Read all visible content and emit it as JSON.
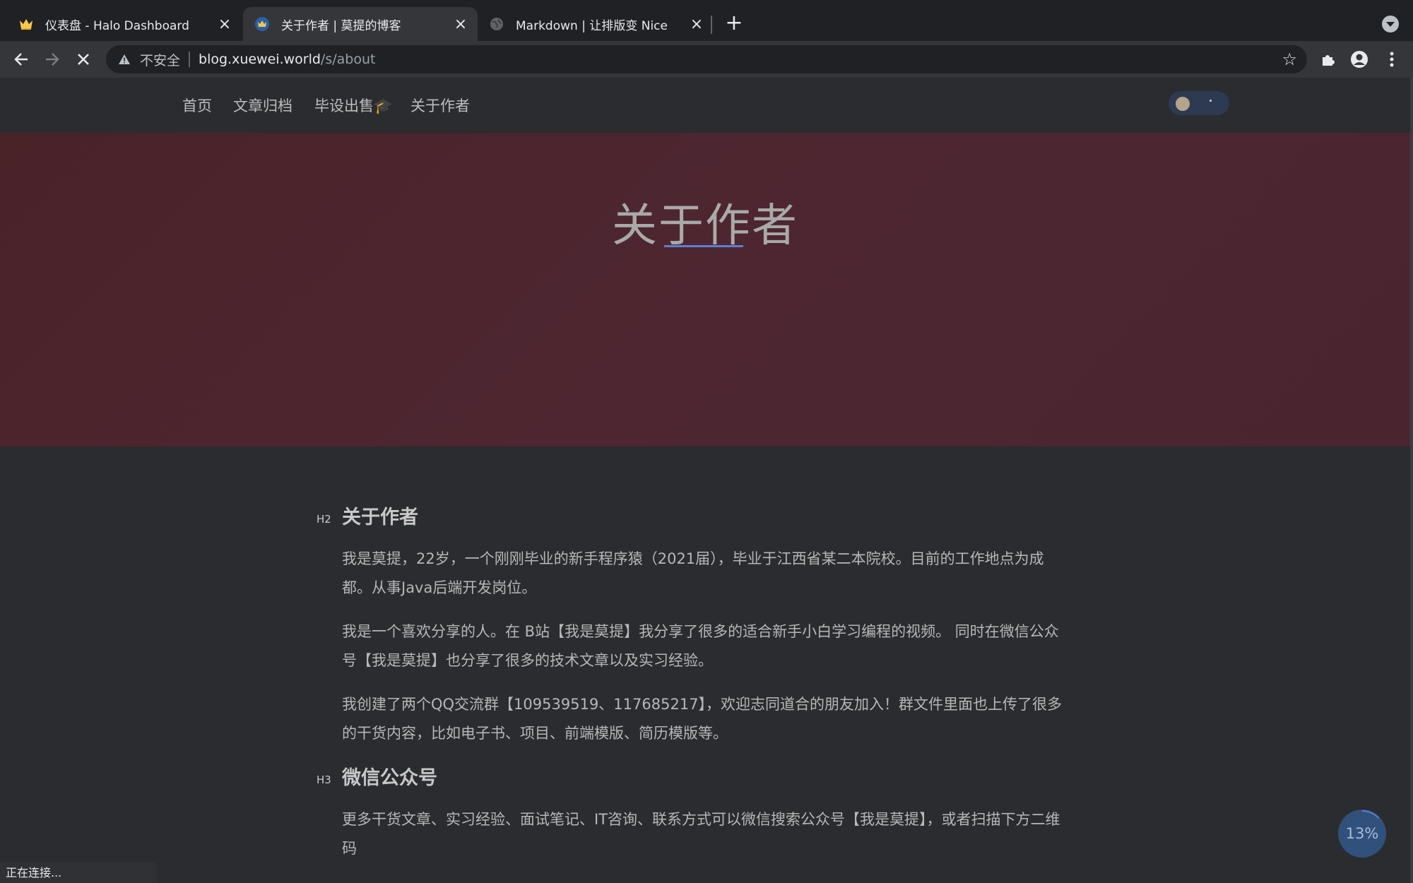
{
  "browser": {
    "tabs": [
      {
        "title": "仪表盘 - Halo Dashboard",
        "icon": "crown-icon",
        "active": false
      },
      {
        "title": "关于作者 | 莫提的博客",
        "icon": "crown-icon",
        "active": true
      },
      {
        "title": "Markdown | 让排版变 Nice",
        "icon": "globe-icon",
        "active": false
      }
    ],
    "address": {
      "security_label": "不安全",
      "host": "blog.xuewei.world",
      "path": "/s/about"
    },
    "status_text": "正在连接..."
  },
  "site": {
    "nav": [
      "首页",
      "文章归档",
      "毕设出售🎓",
      "关于作者"
    ],
    "hero_title": "关于作者",
    "progress_label": "13%",
    "progress_value": 0.13
  },
  "article": {
    "sections": [
      {
        "level": "H2",
        "title": "关于作者",
        "paragraphs": [
          "我是莫提，22岁，一个刚刚毕业的新手程序猿（2021届），毕业于江西省某二本院校。目前的工作地点为成都。从事Java后端开发岗位。",
          "我是一个喜欢分享的人。在 B站【我是莫提】我分享了很多的适合新手小白学习编程的视频。 同时在微信公众号【我是莫提】也分享了很多的技术文章以及实习经验。",
          "我创建了两个QQ交流群【109539519、117685217】，欢迎志同道合的朋友加入！群文件里面也上传了很多的干货内容，比如电子书、项目、前端模版、简历模版等。"
        ]
      },
      {
        "level": "H3",
        "title": "微信公众号",
        "paragraphs": [
          "更多干货文章、实习经验、面试笔记、IT咨询、联系方式可以微信搜索公众号【我是莫提】，或者扫描下方二维码"
        ]
      }
    ]
  },
  "colors": {
    "hero_bg": "#4a2530",
    "accent": "#5b7fd1",
    "progress_bg": "#31507b"
  }
}
